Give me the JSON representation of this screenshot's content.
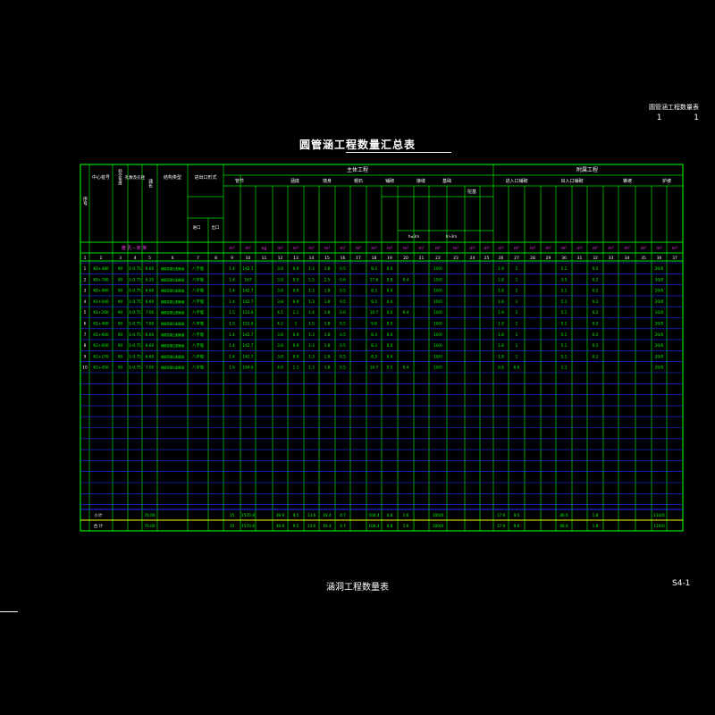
{
  "corner": {
    "label": "圆管涵工程数量表",
    "page": "1",
    "total": "1"
  },
  "title": "圆管涵工程数量汇总表",
  "footer": {
    "title": "涵洞工程数量表",
    "code": "S4-1"
  },
  "colors": {
    "grid": "#00e000",
    "row_line": "#2030ff",
    "text": "#ffffff",
    "units": "#ff40ff",
    "totals": "#ffff00",
    "data": "#00ff00"
  },
  "headers": {
    "seq": "序号",
    "station": "中心桩号",
    "skew": "斜交角度",
    "span": "孔数及孔径",
    "length": "涵长",
    "structure": "结构类型",
    "inlet_outlet": "进出口形式",
    "inlet": "进口",
    "outlet": "出口",
    "main_group": "主体工程",
    "entrance_group": "附属工程",
    "pipe": "管节",
    "base": "涵底",
    "wall": "墙身",
    "cap": "帽石",
    "pave": "铺砌",
    "joint": "接缝",
    "settle": "沉降缝",
    "foundation": "基础",
    "excavation": "挖基",
    "backfill": "回填",
    "inlet_attach": "进入口铺砌",
    "outlet_attach": "出入口铺砌",
    "slope": "锥坡",
    "parapet": "护坡",
    "unit_row": "度 孔－米 米",
    "h1": "h≤3m",
    "h2": "h>3m"
  },
  "units": [
    "m³",
    "m³",
    "kg",
    "m³",
    "m³",
    "m³",
    "m³",
    "m³",
    "m³",
    "m³",
    "m³",
    "m³",
    "m³",
    "m³",
    "m³",
    "m³",
    "m³",
    "m³",
    "m³",
    "m³",
    "m³",
    "m³",
    "m³",
    "m³",
    "m³",
    "m³",
    "m³",
    "m³",
    "m³",
    "m²"
  ],
  "col_numbers": [
    "1",
    "2",
    "3",
    "4",
    "5",
    "6",
    "7",
    "8",
    "9",
    "10",
    "11",
    "12",
    "13",
    "14",
    "15",
    "16",
    "17",
    "18",
    "19",
    "20",
    "21",
    "22",
    "23",
    "24",
    "25",
    "26",
    "27",
    "28",
    "29",
    "30",
    "31",
    "32",
    "33",
    "34",
    "35",
    "36",
    "37"
  ],
  "rows": [
    {
      "no": "1",
      "station": "K0+480",
      "skew": "90",
      "span": "1-0.75",
      "len": "6.60",
      "struct": "钢筋混凝土圆管涵",
      "io": "八字墙",
      "c9": "1.4",
      "c10": "142.7",
      "c12": "3.8",
      "c13": "0.9",
      "c14": "1.3",
      "c15": "1.8",
      "c16": "0.5",
      "c18": "8.3",
      "c19": "0.4",
      "c22": "10/0",
      "c26": "1.9",
      "c27": "1",
      "c30": "5.1",
      "c32": "0.2",
      "c36": "20/0"
    },
    {
      "no": "2",
      "station": "K0+780",
      "skew": "90",
      "span": "1-0.75",
      "len": "6.20",
      "struct": "钢筋混凝土圆管涵",
      "io": "八字墙",
      "c9": "1.4",
      "c10": "167",
      "c12": "3.8",
      "c13": "0.9",
      "c14": "1.5",
      "c15": "2.5",
      "c16": "0.6",
      "c18": "17.6",
      "c19": "0.8",
      "c20": "0.4",
      "c22": "10/0",
      "c26": "1.8",
      "c27": "1",
      "c30": "3.5",
      "c32": "0.2",
      "c36": "30/0"
    },
    {
      "no": "3",
      "station": "K0+960",
      "skew": "90",
      "span": "1-0.75",
      "len": "6.60",
      "struct": "钢筋混凝土圆管涵",
      "io": "八字墙",
      "c9": "1.4",
      "c10": "142.7",
      "c12": "3.8",
      "c13": "0.9",
      "c14": "1.3",
      "c15": "1.8",
      "c16": "0.5",
      "c18": "8.3",
      "c19": "0.4",
      "c22": "10/0",
      "c26": "1.8",
      "c27": "1",
      "c30": "5.1",
      "c32": "0.2",
      "c36": "20/0"
    },
    {
      "no": "4",
      "station": "K1+040",
      "skew": "90",
      "span": "1-0.75",
      "len": "6.60",
      "struct": "钢筋混凝土圆管涵",
      "io": "八字墙",
      "c9": "1.4",
      "c10": "142.7",
      "c12": "3.8",
      "c13": "0.9",
      "c14": "1.3",
      "c15": "1.8",
      "c16": "0.5",
      "c18": "8.3",
      "c19": "0.4",
      "c22": "10/0",
      "c26": "1.8",
      "c27": "1",
      "c30": "5.1",
      "c32": "0.2",
      "c36": "20/0"
    },
    {
      "no": "5",
      "station": "K1+200",
      "skew": "90",
      "span": "1-0.75",
      "len": "7.00",
      "struct": "钢筋混凝土圆管涵",
      "io": "八字墙",
      "c9": "1.5",
      "c10": "151.6",
      "c12": "4.1",
      "c13": "1.1",
      "c14": "1.4",
      "c15": "1.8",
      "c16": "0.6",
      "c18": "10.7",
      "c19": "0.6",
      "c20": "0.4",
      "c22": "10/0",
      "c26": "1.9",
      "c27": "1",
      "c30": "5.1",
      "c32": "0.2",
      "c36": "10/0"
    },
    {
      "no": "6",
      "station": "K1+400",
      "skew": "90",
      "span": "1-0.75",
      "len": "7.00",
      "struct": "钢筋混凝土圆管涵",
      "io": "八字墙",
      "c9": "1.5",
      "c10": "151.6",
      "c12": "4.2",
      "c13": "1",
      "c14": "1.5",
      "c15": "1.8",
      "c16": "0.5",
      "c18": "9.8",
      "c19": "0.5",
      "c22": "10/0",
      "c26": "1.9",
      "c27": "1",
      "c30": "5.1",
      "c32": "0.2",
      "c36": "20/0"
    },
    {
      "no": "7",
      "station": "K1+600",
      "skew": "90",
      "span": "1-0.75",
      "len": "6.60",
      "struct": "钢筋混凝土圆管涵",
      "io": "八字墙",
      "c9": "1.4",
      "c10": "142.7",
      "c12": "3.8",
      "c13": "0.9",
      "c14": "1.3",
      "c15": "1.8",
      "c16": "0.5",
      "c18": "8.3",
      "c19": "0.4",
      "c22": "10/0",
      "c26": "1.8",
      "c27": "1",
      "c30": "5.1",
      "c32": "0.2",
      "c36": "20/0"
    },
    {
      "no": "8",
      "station": "K2+000",
      "skew": "90",
      "span": "1-0.75",
      "len": "6.60",
      "struct": "钢筋混凝土圆管涵",
      "io": "八字墙",
      "c9": "1.4",
      "c10": "142.7",
      "c12": "3.8",
      "c13": "0.9",
      "c14": "1.3",
      "c15": "1.8",
      "c16": "0.5",
      "c18": "8.3",
      "c19": "0.4",
      "c22": "10/0",
      "c26": "1.8",
      "c27": "1",
      "c30": "5.1",
      "c32": "0.2",
      "c36": "20/0"
    },
    {
      "no": "9",
      "station": "K2+270",
      "skew": "90",
      "span": "1-0.75",
      "len": "6.60",
      "struct": "钢筋混凝土圆管涵",
      "io": "八字墙",
      "c9": "1.4",
      "c10": "142.7",
      "c12": "3.8",
      "c13": "0.9",
      "c14": "1.3",
      "c15": "1.8",
      "c16": "0.5",
      "c18": "8.3",
      "c19": "0.4",
      "c22": "10/0",
      "c26": "1.8",
      "c27": "1",
      "c30": "5.1",
      "c32": "0.2",
      "c36": "20/0"
    },
    {
      "no": "10",
      "station": "K2+450",
      "skew": "90",
      "span": "1-0.75",
      "len": "7.00",
      "struct": "钢筋混凝土圆管涵",
      "io": "八字墙",
      "c9": "1.6",
      "c10": "164.6",
      "c12": "4.8",
      "c13": "1.1",
      "c14": "1.3",
      "c15": "1.8",
      "c16": "0.5",
      "c18": "10.7",
      "c19": "0.5",
      "c20": "0.4",
      "c22": "10/0",
      "c26": "8.8",
      "c27": "6.6",
      "c30": "2.3",
      "c36": "20/0"
    }
  ],
  "subtotal": {
    "label": "小计",
    "len": "70.00",
    "c9": "15",
    "c10": "1570.8",
    "c12": "39.9",
    "c13": "9.5",
    "c14": "13.6",
    "c15": "19.4",
    "c16": "4.7",
    "c18": "104.4",
    "c19": "4.8",
    "c20": "1.6",
    "c22": "100/0",
    "c26": "17.9",
    "c27": "9.5",
    "c30": "46.6",
    "c32": "1.8",
    "c36": "110/0"
  },
  "total": {
    "label": "合 计",
    "len": "70.00",
    "c9": "15",
    "c10": "1570.8",
    "c12": "39.9",
    "c13": "9.5",
    "c14": "13.6",
    "c15": "19.4",
    "c16": "4.7",
    "c18": "104.4",
    "c19": "4.8",
    "c20": "1.6",
    "c22": "100/0",
    "c26": "17.9",
    "c27": "9.6",
    "c30": "46.6",
    "c32": "1.8",
    "c36": "110/0"
  }
}
